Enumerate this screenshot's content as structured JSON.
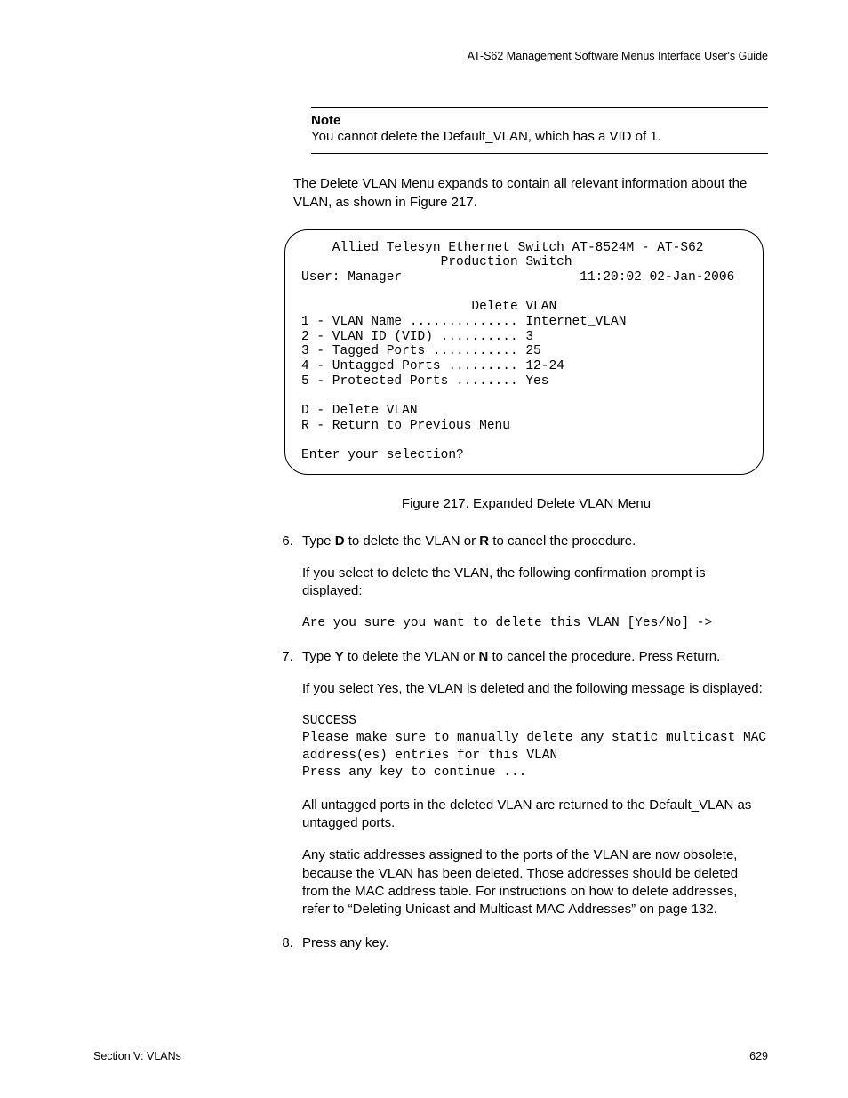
{
  "header": {
    "guide": "AT-S62 Management Software Menus Interface User's Guide"
  },
  "note": {
    "title": "Note",
    "body": "You cannot delete the Default_VLAN, which has a VID of 1."
  },
  "intro": "The Delete VLAN Menu expands to contain all relevant information about the VLAN, as shown in Figure 217.",
  "terminal": "    Allied Telesyn Ethernet Switch AT-8524M - AT-S62\n                  Production Switch\nUser: Manager                       11:20:02 02-Jan-2006\n\n                      Delete VLAN\n1 - VLAN Name .............. Internet_VLAN\n2 - VLAN ID (VID) .......... 3\n3 - Tagged Ports ........... 25\n4 - Untagged Ports ......... 12-24\n5 - Protected Ports ........ Yes\n\nD - Delete VLAN\nR - Return to Previous Menu\n\nEnter your selection?",
  "figure_caption": "Figure 217. Expanded Delete VLAN Menu",
  "steps": {
    "s6": {
      "pre": "Type ",
      "b1": "D",
      "mid1": " to delete the VLAN or ",
      "b2": "R",
      "post": " to cancel the procedure.",
      "sub1": "If you select to delete the VLAN, the following confirmation prompt is displayed:",
      "code": "Are you sure you want to delete this VLAN [Yes/No] ->"
    },
    "s7": {
      "pre": "Type ",
      "b1": "Y",
      "mid1": " to delete the VLAN or ",
      "b2": "N",
      "post": " to cancel the procedure. Press Return.",
      "sub1": "If you select Yes, the VLAN is deleted and the following message is displayed:",
      "code": "SUCCESS\nPlease make sure to manually delete any static multicast MAC address(es) entries for this VLAN\nPress any key to continue ...",
      "sub2": "All untagged ports in the deleted VLAN are returned to the Default_VLAN as untagged ports.",
      "sub3": "Any static addresses assigned to the ports of the VLAN are now obsolete, because the VLAN has been deleted. Those addresses should be deleted from the MAC address table. For instructions on how to delete addresses, refer to “Deleting Unicast and Multicast MAC Addresses” on page 132."
    },
    "s8": {
      "main": "Press any key."
    }
  },
  "footer": {
    "left": "Section V: VLANs",
    "right": "629"
  }
}
